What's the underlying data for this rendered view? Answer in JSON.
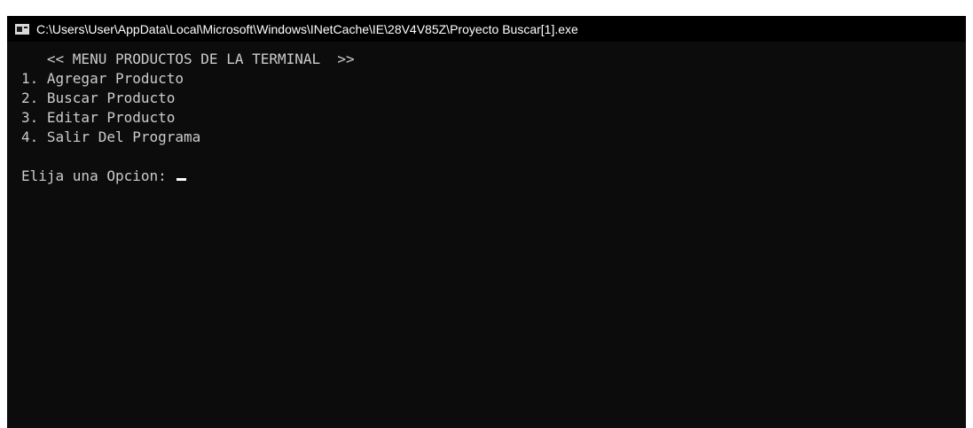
{
  "window": {
    "title": "C:\\Users\\User\\AppData\\Local\\Microsoft\\Windows\\INetCache\\IE\\28V4V85Z\\Proyecto Buscar[1].exe",
    "icon": "console-app-icon"
  },
  "console": {
    "header": "   << MENU PRODUCTOS DE LA TERMINAL  >>",
    "options": [
      "1. Agregar Producto",
      "2. Buscar Producto",
      "3. Editar Producto",
      "4. Salir Del Programa"
    ],
    "prompt": "Elija una Opcion: ",
    "input_value": ""
  },
  "colors": {
    "titlebar_bg": "#000000",
    "console_bg": "#0c0c0c",
    "console_text": "#cccccc",
    "cursor": "#ffffff"
  }
}
